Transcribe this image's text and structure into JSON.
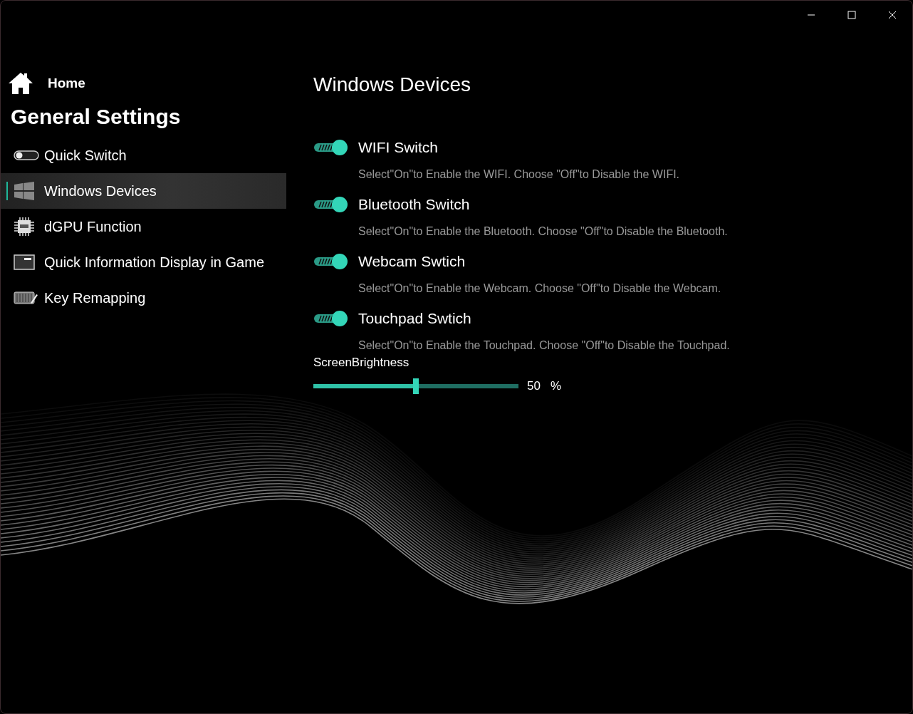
{
  "sidebar": {
    "home": "Home",
    "heading": "General Settings",
    "items": [
      {
        "label": "Quick Switch",
        "kind": "toggle",
        "selected": false
      },
      {
        "label": "Windows Devices",
        "kind": "windows",
        "selected": true
      },
      {
        "label": "dGPU Function",
        "kind": "chip",
        "selected": false
      },
      {
        "label": "Quick Information Display in Game",
        "kind": "display",
        "selected": false
      },
      {
        "label": "Key Remapping",
        "kind": "keyboard",
        "selected": false
      }
    ]
  },
  "page": {
    "title": "Windows Devices",
    "switches": [
      {
        "label": "WIFI Switch",
        "on": true,
        "description": "Select\"On\"to Enable the WIFI. Choose \"Off\"to Disable the WIFI."
      },
      {
        "label": "Bluetooth Switch",
        "on": true,
        "description": "Select\"On\"to Enable the Bluetooth. Choose \"Off\"to Disable the Bluetooth."
      },
      {
        "label": "Webcam Swtich",
        "on": true,
        "description": "Select\"On\"to Enable the Webcam. Choose \"Off\"to Disable the Webcam."
      },
      {
        "label": "Touchpad Swtich",
        "on": true,
        "description": "Select\"On\"to Enable the Touchpad. Choose \"Off\"to Disable the Touchpad."
      }
    ],
    "brightness": {
      "label": "ScreenBrightness",
      "level": 0.5,
      "value": "50",
      "unit": "%"
    }
  }
}
